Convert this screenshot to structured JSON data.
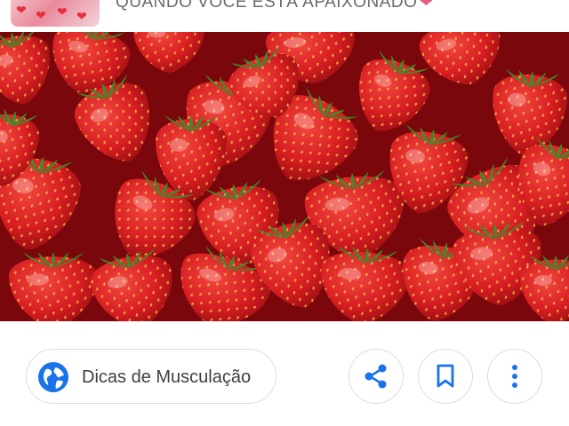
{
  "header": {
    "headline": "QUANDO VOCÊ ESTÁ APAIXONADO",
    "heart_glyph": "❤"
  },
  "image": {
    "subject": "strawberries",
    "colors": {
      "berry": "#d81e22",
      "berry_dark": "#a30d12",
      "leaf": "#3f8a2a"
    }
  },
  "actions": {
    "source_chip_label": "Dicas de Musculação",
    "source_icon": "globe-icon",
    "share_icon": "share-icon",
    "bookmark_icon": "bookmark-icon",
    "more_icon": "more-vert-icon",
    "accent_color": "#1a73e8"
  }
}
